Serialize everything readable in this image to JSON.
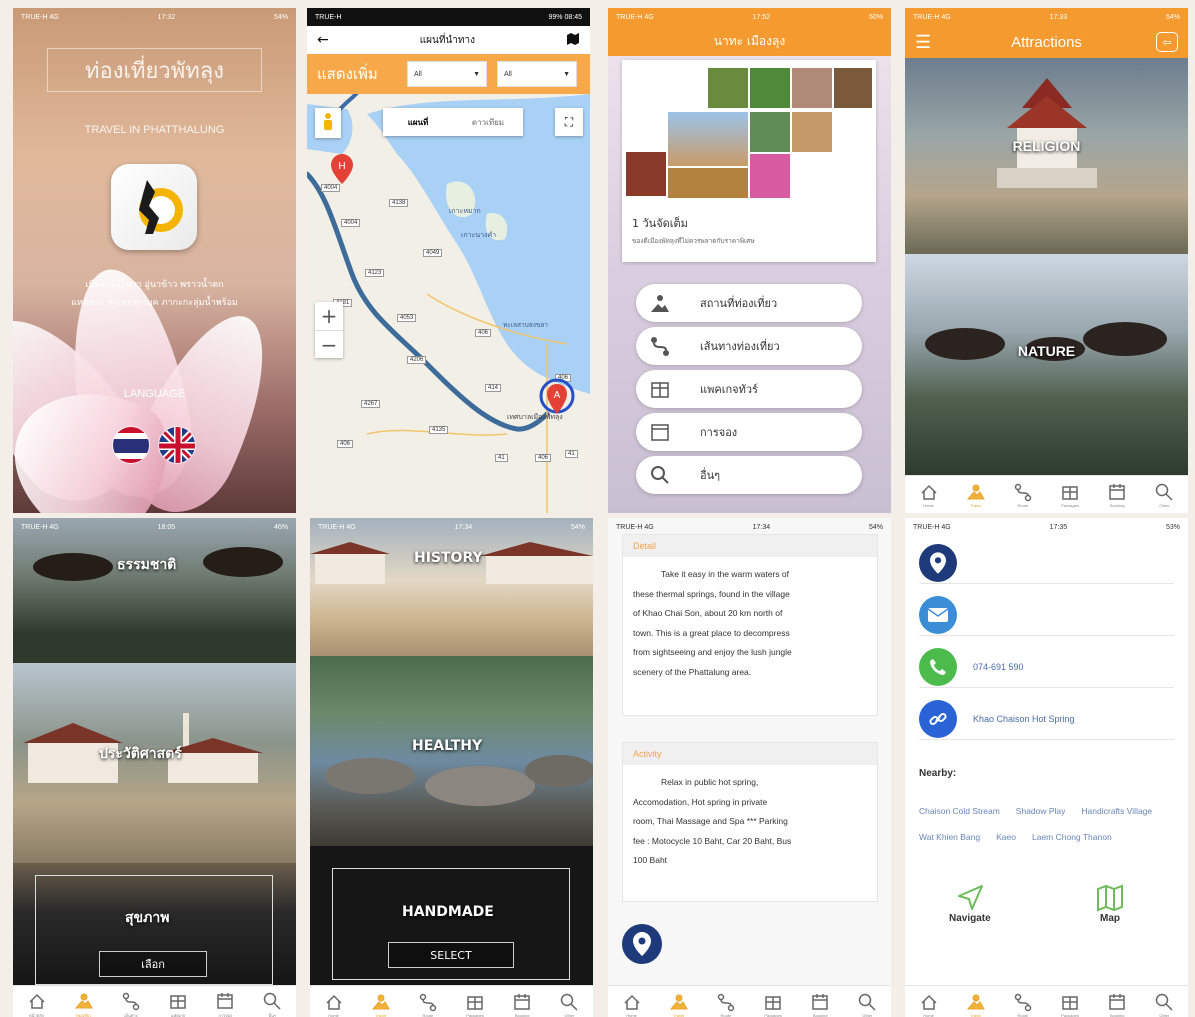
{
  "colors": {
    "accent": "#f59a2e",
    "tab_active": "#e8a52c",
    "link": "#4a6ea8"
  },
  "p1": {
    "status": {
      "carrier": "TRUE-H  4G",
      "time": "17:32",
      "battery": "54%"
    },
    "title": "ท่องเที่ยวพัทลุง",
    "subtitle": "TRAVEL IN PHATTHALUNG",
    "desc_line1": "เมืองหนังโนรา อู่นาข้าว พราวน้ำตก",
    "desc_line2": "แหล่งนก กะเหรากาบุค ภากะกะลุ่มน้ำพร้อม",
    "language_label": "LANGUAGE"
  },
  "p2": {
    "status": {
      "carrier": "TRUE-H",
      "time": "08:45",
      "battery": "99%"
    },
    "title": "แผนที่นำทาง",
    "filter_label": "แสดงเพิ่ม",
    "select1": "All",
    "select2": "All",
    "toggle_map": "แผนที่",
    "toggle_sat": "ดาวเทียม",
    "places": [
      "เกาะหมาก",
      "เกาะนางคำ",
      "ทะเลสาบสงขลา",
      "เทศบาลเมืองพัทลุง"
    ],
    "roads": [
      "4004",
      "4138",
      "4004",
      "4049",
      "4123",
      "4181",
      "4053",
      "406",
      "4206",
      "414",
      "406",
      "4267",
      "4135",
      "41",
      "406",
      "406",
      "41"
    ],
    "marker_a": "A",
    "marker_h": "H"
  },
  "p3": {
    "status": {
      "carrier": "TRUE-H  4G",
      "time": "17:52",
      "battery": "50%"
    },
    "title": "นาทะ เมืองลุง",
    "card_title": "1 วันจัดเต็ม",
    "card_sub": "ของดีเมืองพัทลุงที่ไม่ควรพลาดกับราคาพิเศษ",
    "menu": [
      "สถานที่ท่องเที่ยว",
      "เส้นทางท่องเที่ยว",
      "แพคเกจทัวร์",
      "การจอง",
      "อื่นๆ"
    ]
  },
  "p4": {
    "status": {
      "carrier": "TRUE-H  4G",
      "time": "17:33",
      "battery": "54%"
    },
    "title": "Attractions",
    "categories": [
      "RELIGION",
      "NATURE"
    ]
  },
  "p5": {
    "status": {
      "carrier": "TRUE-H  4G",
      "time": "18:05",
      "battery": "46%"
    },
    "categories": [
      "ธรรมชาติ",
      "ประวัติศาสตร์",
      "สุขภาพ"
    ],
    "select": "เลือก"
  },
  "p6": {
    "status": {
      "carrier": "TRUE-H  4G",
      "time": "17:34",
      "battery": "54%"
    },
    "categories": [
      "HISTORY",
      "HEALTHY",
      "HANDMADE"
    ],
    "select": "SELECT"
  },
  "p7": {
    "status": {
      "carrier": "TRUE-H  4G",
      "time": "17:34",
      "battery": "54%"
    },
    "detail_h": "Detail",
    "detail": [
      "Take it easy in the warm waters of",
      "these thermal springs, found in the village",
      "of Khao Chai Son, about 20 km north of",
      "town. This is a great place to decompress",
      "from sightseeing and enjoy the lush jungle",
      "scenery of the Phattalung area."
    ],
    "activity_h": "Activity",
    "activity": [
      "Relax in public hot spring,",
      "Accomodation, Hot spring in private",
      "room, Thai Massage and Spa *** Parking",
      "fee : Motocycle 10 Baht, Car 20 Baht, Bus",
      "100 Baht"
    ]
  },
  "p8": {
    "status": {
      "carrier": "TRUE-H  4G",
      "time": "17:35",
      "battery": "53%"
    },
    "phone": "074-691 590",
    "link": "Khao Chaison Hot Spring",
    "nearby_h": "Nearby:",
    "nearby": [
      "Chaison Cold Stream",
      "Shadow Play",
      "Handicrafts Village",
      "Wat Khien Bang",
      "Kaeo",
      "Laem Chong Thanon"
    ],
    "navigate": "Navigate",
    "map": "Map"
  },
  "tabs_th": [
    "หน้าหลัก",
    "ท่องเที่ยว",
    "เส้นทาง",
    "แพคเกจ",
    "การจอง",
    "อื่นๆ"
  ],
  "tabs_en": [
    "Home",
    "Travel",
    "Route",
    "Packages",
    "Booking",
    "Other"
  ]
}
